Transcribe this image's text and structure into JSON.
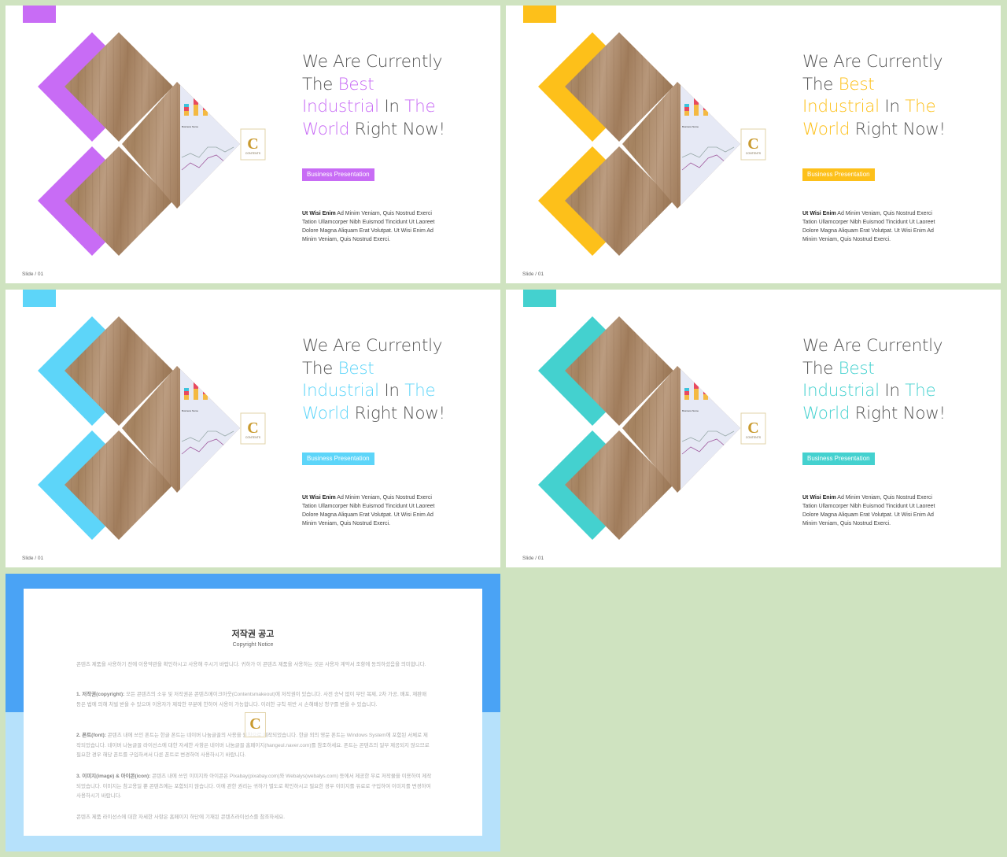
{
  "background_color": "#cfe3c0",
  "slides": [
    {
      "accent": "#c86cf5"
    },
    {
      "accent": "#fdc01a"
    },
    {
      "accent": "#5dd5f9"
    },
    {
      "accent": "#44d1cf"
    }
  ],
  "slide_text": {
    "title_line1": "We Are Currently",
    "the": "The ",
    "best": "Best",
    "industrial": "Industrial",
    "in": " In ",
    "the2": "The",
    "world": "World",
    "right_now": " Right Now!",
    "badge": "Business Presentation",
    "body_bold": "Ut Wisi Enim",
    "body": " Ad Minim Veniam, Quis Nostrud Exerci Tation Ullamcorper Nibh Euismod Tincidunt Ut Laoreet Dolore Magna Aliquam Erat Volutpat. Ut Wisi Enim Ad Minim Veniam, Quis Nostrud Exerci.",
    "slide_number": "Slide / 01",
    "logo_letter": "C",
    "logo_text": "CONTENTS",
    "chart_label": "Business Name"
  },
  "copyright": {
    "title": "저작권 공고",
    "subtitle": "Copyright Notice",
    "intro": "콘텐츠 제품을 사용하기 전에 이용약관을 확인하시고 사용해 주시기 바랍니다. 귀하가 이 콘텐츠 제품을 사용하는 것은 사용자 계약서 조항에 동의하셨음을 의미합니다.",
    "s1_head": "1. 저작권(copyright):",
    "s1": " 모든 콘텐츠의 소유 및 저작권은 콘텐츠메이크아웃(Contentsmakeout)에 저작권이 있습니다. 사전 승낙 없이 무단 복제, 2차 가공, 배포, 재판매 등은 법에 의해 처벌 받을 수 있으며 이용자가 제작한 부분에 한하여 사용이 가능합니다. 이러한 규칙 위반 시 손해배상 청구를 받을 수 있습니다.",
    "s2_head": "2. 폰트(font):",
    "s2": " 콘텐츠 내에 쓰인 폰트는 한글 폰트는 네이버 나눔글꼴의 사용을 원칙으로 제작되었습니다. 한글 외의 영문 폰트는 Windows System에 포함된 서체로 제작되었습니다. 네이버 나눔글꼴 라이선스에 대한 자세한 사항은 네이버 나눔글꼴 홈페이지(hangeul.naver.com)를 참조하세요. 폰트는 콘텐츠의 일부 제공되지 않으므로 필요한 경우 해당 폰트를 구입하셔서 다른 폰트로 변경하여 사용하시기 바랍니다.",
    "s3_head": "3. 이미지(image) & 아이콘(icon):",
    "s3": " 콘텐츠 내에 쓰인 이미지와 아이콘은 Pixabay(pixabay.com)와 Webalys(webalys.com) 등에서 제공한 무료 저작물을 이용하여 제작되었습니다. 이미지는 참고용일 뿐 콘텐츠에는 포함되지 않습니다. 이에 관한 권리는 귀하가 별도로 확인하시고 필요한 경우 이미지를 유료로 구입하여 이미지를 변경하여 사용하시기 바랍니다.",
    "outro": "콘텐츠 제품 라이선스에 대한 자세한 사항은 홈페이지 하단에 기재된 콘텐츠라이선스를 참조하세요."
  }
}
